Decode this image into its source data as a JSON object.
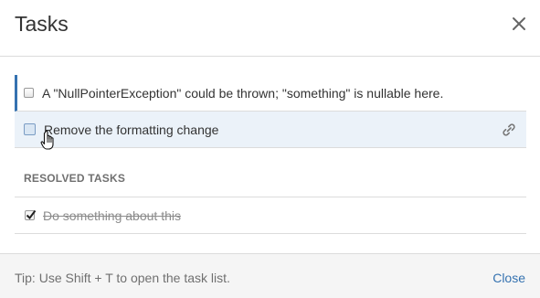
{
  "dialog": {
    "title": "Tasks",
    "close_icon": "close-icon"
  },
  "open_tasks": [
    {
      "text": "A \"NullPointerException\" could be thrown; \"something\" is nullable here.",
      "checked": false
    },
    {
      "text": "Remove the formatting change",
      "checked": false,
      "icon": "link-icon"
    }
  ],
  "resolved": {
    "heading": "RESOLVED TASKS",
    "items": [
      {
        "text": "Do something about this",
        "checked": true
      }
    ]
  },
  "footer": {
    "tip": "Tip: Use Shift + T to open the task list.",
    "close_label": "Close"
  },
  "colors": {
    "accent": "#3572b0",
    "hover_row": "#ebf2f9",
    "footer_bg": "#f5f5f5"
  }
}
